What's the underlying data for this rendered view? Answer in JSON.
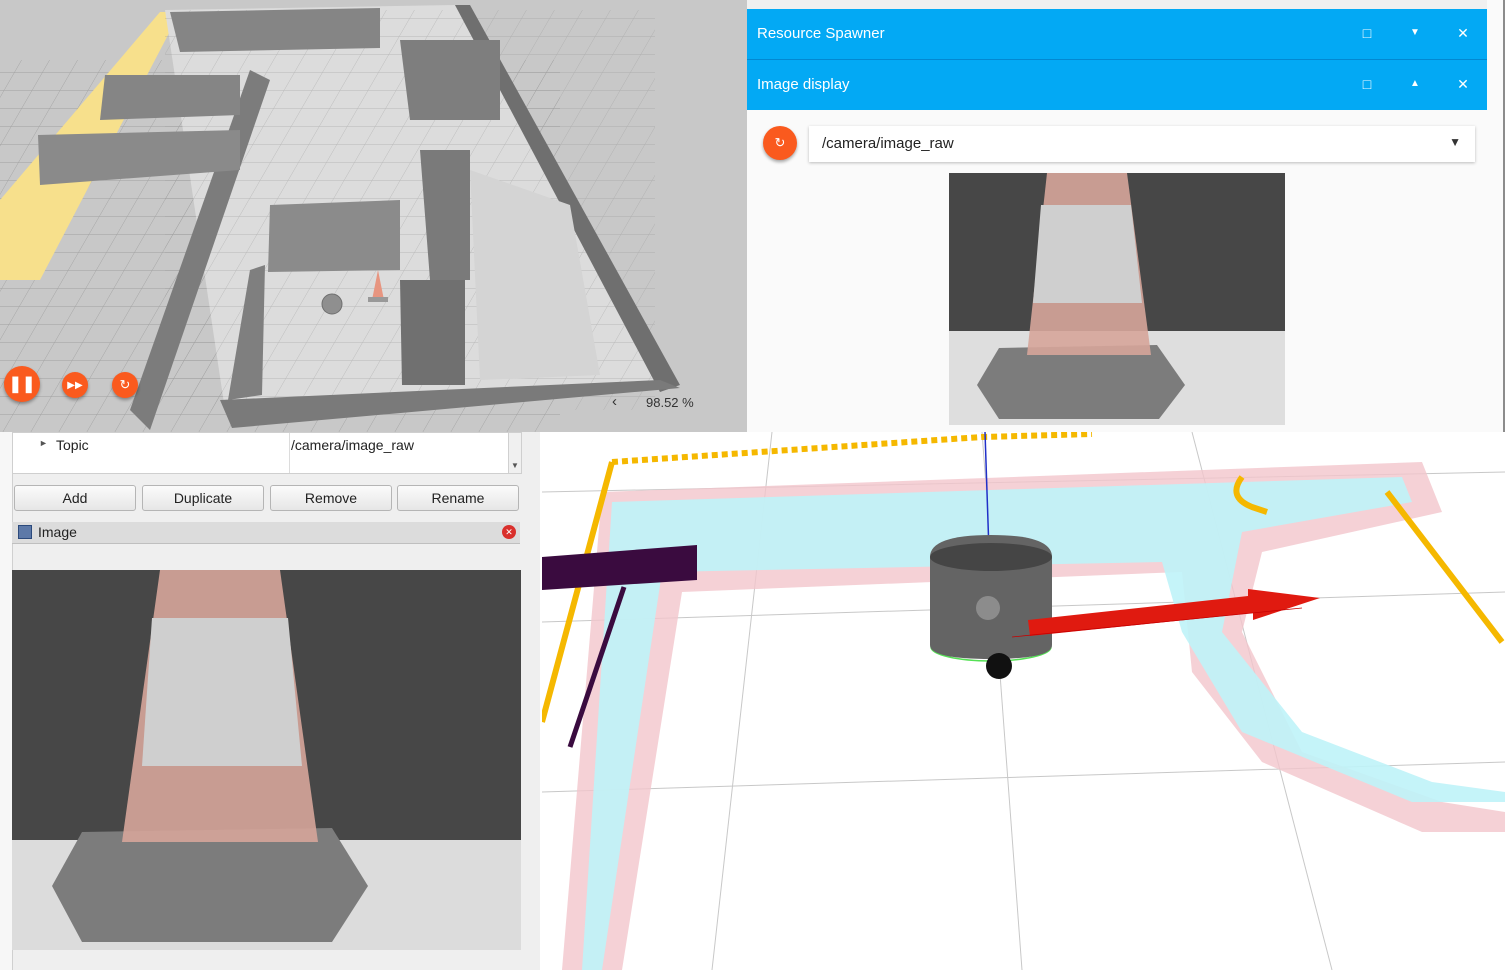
{
  "simulator": {
    "realtime_factor": "98.52 %",
    "controls": {
      "pause": "pause-icon",
      "step": "fast-forward-icon",
      "reset": "reset-icon"
    }
  },
  "webpanel": {
    "resource_spawner": {
      "title": "Resource Spawner"
    },
    "image_display": {
      "title": "Image display",
      "topic": "/camera/image_raw"
    },
    "accent": "#03a9f4",
    "button_color": "#fa5a1e"
  },
  "rviz_panel": {
    "property": {
      "name": "Topic",
      "value": "/camera/image_raw"
    },
    "buttons": {
      "add": "Add",
      "duplicate": "Duplicate",
      "remove": "Remove",
      "rename": "Rename"
    },
    "image_panel_title": "Image"
  }
}
